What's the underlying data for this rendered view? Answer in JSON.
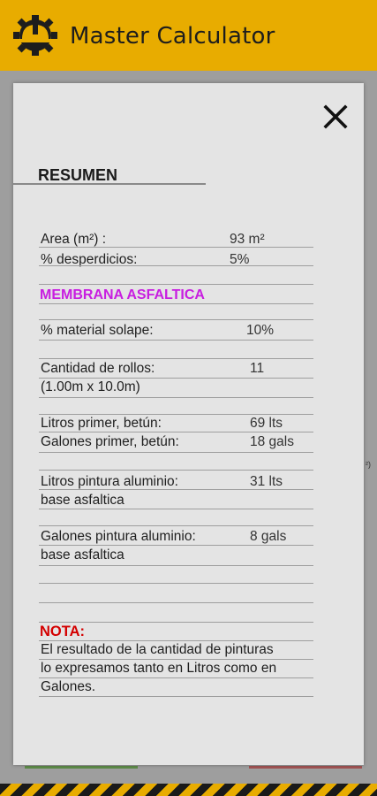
{
  "app": {
    "title": "Master Calculator"
  },
  "background": {
    "fragment": "²)"
  },
  "dialog": {
    "heading": "RESUMEN",
    "rows": {
      "area": {
        "label": "Area (m²) :",
        "value": "93 m²"
      },
      "desperdicios": {
        "label": "% desperdicios:",
        "value": "5%"
      },
      "solape": {
        "label": "% material solape:",
        "value": "10%"
      },
      "rollos": {
        "label_line1": "Cantidad de rollos:",
        "label_line2": "(1.00m x 10.0m)",
        "value": "11"
      },
      "litros_primer": {
        "label": "Litros primer, betún:",
        "value": "69 lts"
      },
      "galones_primer": {
        "label": "Galones primer, betún:",
        "value": "18 gals"
      },
      "litros_pintura": {
        "label_line1": "Litros pintura aluminio:",
        "label_line2": "base asfaltica",
        "value": "31 lts"
      },
      "galones_pintura": {
        "label_line1": "Galones pintura aluminio:",
        "label_line2": "base asfaltica",
        "value": "8 gals"
      }
    },
    "section_title": "MEMBRANA ASFALTICA",
    "nota": {
      "label": "NOTA:",
      "line1": "El resultado de la cantidad de pinturas",
      "line2": "lo expresamos tanto en Litros como en",
      "line3": "Galones."
    }
  },
  "colors": {
    "appbar": "#e8ac00",
    "section": "#c81ee0",
    "nota": "#d40000"
  },
  "icons": {
    "logo": "helmet-gear-icon",
    "close": "close-icon"
  }
}
